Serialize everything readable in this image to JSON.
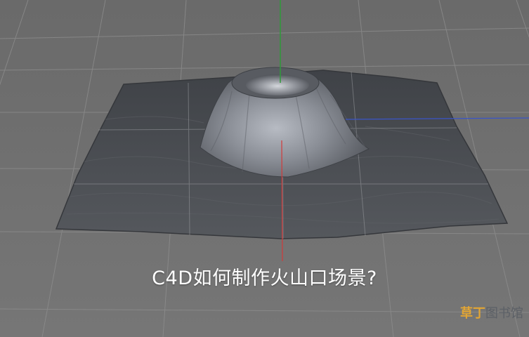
{
  "viewport": {
    "background_color": "#6f6f6f",
    "grid_color": "#8a8a8a",
    "terrain_color": "#4a4d52",
    "axis_colors": {
      "x": "#d23a3a",
      "y": "#2f9a3a",
      "z": "#3a55c8"
    }
  },
  "caption": {
    "text": "C4D如何制作火山口场景?"
  },
  "watermark": {
    "part1": "草丁",
    "part2": "图书馆"
  }
}
